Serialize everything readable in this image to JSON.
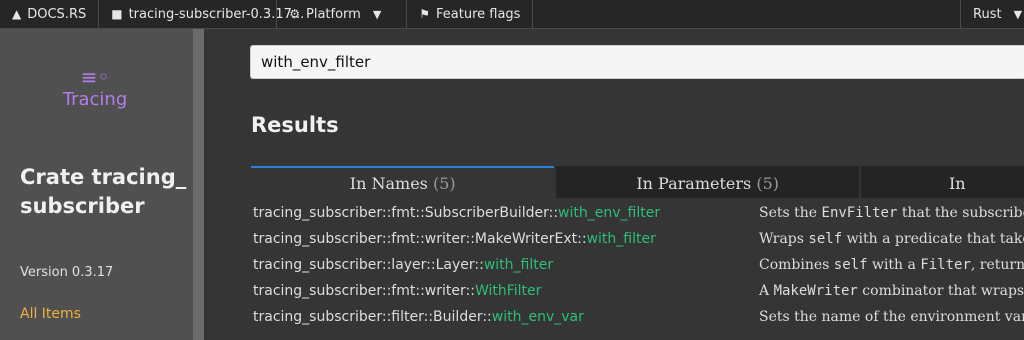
{
  "topbar": {
    "docs_label": "DOCS.RS",
    "crate_label": "tracing-subscriber-0.3.17...",
    "platform_label": "Platform",
    "flags_label": "Feature flags",
    "rust_label": "Rust"
  },
  "sidebar": {
    "logo_text": "Tracing",
    "crate_heading": "Crate tracing_subscriber",
    "version": "Version 0.3.17",
    "all_items": "All Items"
  },
  "search": {
    "value": "with_env_filter"
  },
  "results": {
    "title": "Results",
    "tabs": [
      {
        "label": "In Names",
        "count": "(5)"
      },
      {
        "label": "In Parameters",
        "count": "(5)"
      },
      {
        "label": "In",
        "count": ""
      }
    ],
    "rows": [
      {
        "prefix": "tracing_subscriber::fmt::SubscriberBuilder::",
        "name": "with_env_filter",
        "desc_a": "Sets the ",
        "desc_code": "EnvFilter",
        "desc_b": " that the subscriber"
      },
      {
        "prefix": "tracing_subscriber::fmt::writer::MakeWriterExt::",
        "name": "with_filter",
        "desc_a": "Wraps ",
        "desc_code": "self",
        "desc_b": " with a predicate that takes"
      },
      {
        "prefix": "tracing_subscriber::layer::Layer::",
        "name": "with_filter",
        "desc_a": "Combines ",
        "desc_code": "self",
        "desc_b": " with a ",
        "desc_code2": "Filter",
        "desc_c": ", returns"
      },
      {
        "prefix": "tracing_subscriber::fmt::writer::",
        "name": "WithFilter",
        "desc_a": "A ",
        "desc_code": "MakeWriter",
        "desc_b": " combinator that wraps"
      },
      {
        "prefix": "tracing_subscriber::filter::Builder::",
        "name": "with_env_var",
        "desc_a": "Sets the name of the environment variable",
        "desc_code": "",
        "desc_b": ""
      }
    ]
  },
  "colors": {
    "accent_blue": "#2a7fd6",
    "match_green": "#2dbf78",
    "all_items_orange": "#f0b040",
    "logo_purple": "#b17ee8"
  }
}
